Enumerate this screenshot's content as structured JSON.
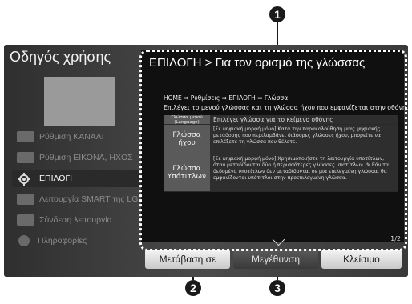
{
  "callouts": {
    "c1": "1",
    "c2": "2",
    "c3": "3"
  },
  "app": {
    "title": "Οδηγός χρήσης"
  },
  "sidebar": {
    "items": [
      {
        "label": "Ρύθμιση ΚΑΝΑΛΙ",
        "icon": "channel-icon"
      },
      {
        "label": "Ρύθμιση ΕΙΚΟΝΑ, ΗΧΟΣ",
        "icon": "picture-sound-icon"
      },
      {
        "label": "ΕΠΙΛΟΓΗ",
        "icon": "gear-icon",
        "active": true
      },
      {
        "label": "Λειτουργία SMART της LG",
        "icon": "smart-icon"
      },
      {
        "label": "Σύνδεση λειτουργία",
        "icon": "connection-icon"
      },
      {
        "label": "Πληροφορίες",
        "icon": "info-icon"
      }
    ]
  },
  "panel": {
    "title": "ΕΠΙΛΟΓΗ > Για τον ορισμό της γλώσσας",
    "breadcrumb": "HOME ⇨ Ρυθμίσεις ➡ ΕΠΙΛΟΓΗ ➡ Γλώσσα",
    "description": "Επιλέγει το μενού γλώσσας και τη γλώσσα ήχου που εμφανίζεται στην οθόνη.",
    "rows": [
      {
        "key": "Γλώσσα μενού (Language)",
        "value": "Επιλέγει γλώσσα για το κείμενο οθόνης"
      },
      {
        "key": "Γλώσσα ήχου",
        "value": "[Σε ψηφιακή μορφή μόνο] Κατά την παρακολούθηση μιας ψηφιακής μετάδοσης που περιλαμβάνει διάφορες γλώσσες ήχου, μπορείτε να επιλέξετε τη γλώσσα που θέλετε."
      },
      {
        "key": "Γλώσσα Υπότιτλων",
        "value": "[Σε ψηφιακή μορφή μόνο] Χρησιμοποιήστε τη λειτουργία υποτίτλων, όταν μεταδίδονται δύο ή περισσότερες γλώσσες υποτίτλων. ✎ Εάν τα δεδομένα υποτίτλων δεν μεταδίδονται σε μια επιλεγμένη γλώσσα, θα εμφανίζονται υπότιτλοι στην προεπιλεγμένη γλώσσα."
      }
    ],
    "page": "1/2"
  },
  "buttons": {
    "goto": "Μετάβαση σε",
    "zoom": "Μεγέθυνση",
    "close": "Κλείσιμο"
  }
}
